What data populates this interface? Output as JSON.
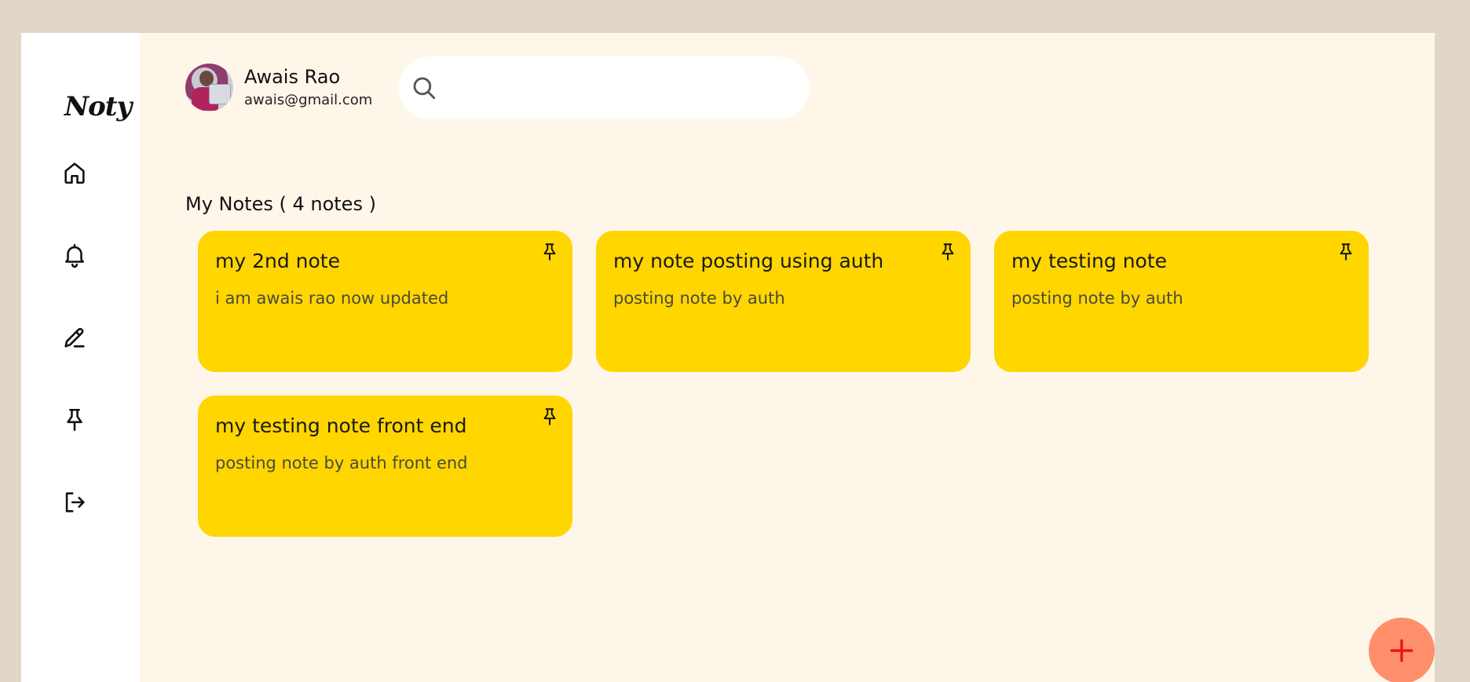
{
  "app": {
    "logo": "Noty"
  },
  "sidebar": {
    "items": [
      {
        "name": "home",
        "icon": "home-icon"
      },
      {
        "name": "notifications",
        "icon": "bell-icon"
      },
      {
        "name": "edit",
        "icon": "pencil-icon"
      },
      {
        "name": "pinned",
        "icon": "pin-icon"
      },
      {
        "name": "logout",
        "icon": "logout-icon"
      }
    ]
  },
  "user": {
    "name": "Awais Rao",
    "email": "awais@gmail.com"
  },
  "search": {
    "placeholder": "",
    "value": ""
  },
  "notes_section": {
    "title": "My Notes ( 4 notes )"
  },
  "notes": [
    {
      "title": "my 2nd note",
      "body": "i am awais rao now updated"
    },
    {
      "title": "my note posting using auth",
      "body": "posting note by auth"
    },
    {
      "title": "my testing note",
      "body": "posting note by auth"
    },
    {
      "title": "my testing note front end",
      "body": "posting note by auth front end"
    }
  ],
  "fab": {
    "icon": "plus-icon"
  },
  "colors": {
    "page_bg": "#e0d7c7",
    "app_bg": "#fff6ea",
    "sidebar_bg": "#ffffff",
    "note_bg": "#ffd600",
    "fab_bg": "#ff8f6b",
    "fab_icon": "#e8141c"
  }
}
